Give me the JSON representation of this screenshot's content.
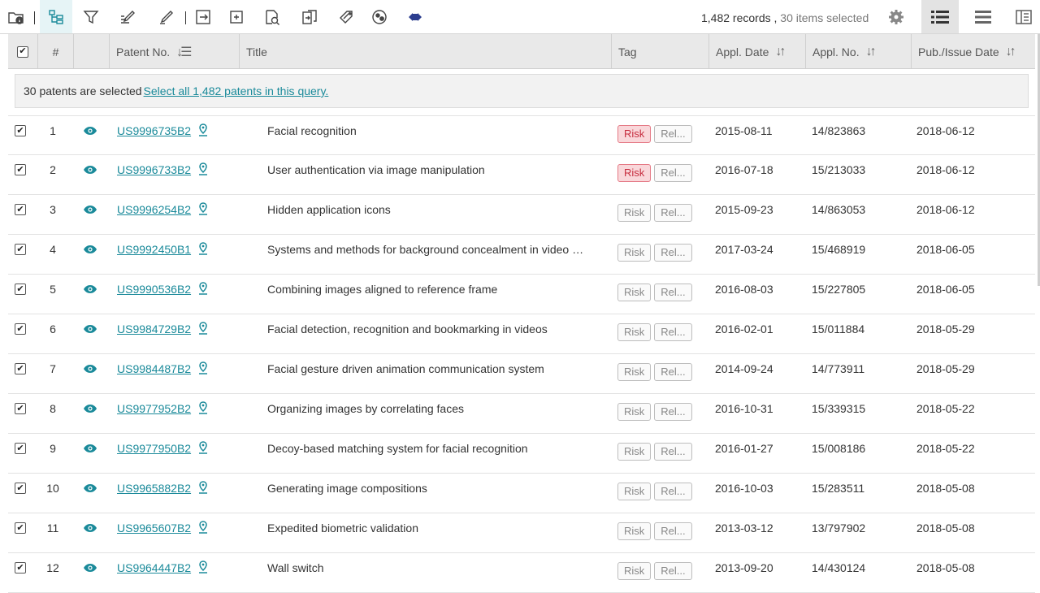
{
  "toolbar": {
    "records_text": "1,482 records ,",
    "selected_text": "30 items selected",
    "icons": [
      "folder-info-icon",
      "tree-view-icon",
      "filter-icon",
      "edit-list-icon",
      "highlight-pen-icon",
      "export-icon",
      "add-icon",
      "search-doc-icon",
      "compare-icon",
      "tag-icon",
      "analytics-icon",
      "collapse-icon",
      "settings-icon",
      "list-view-icon",
      "compact-view-icon",
      "split-view-icon"
    ]
  },
  "table": {
    "headers": {
      "number": "#",
      "patent_no": "Patent No.",
      "title": "Title",
      "tag": "Tag",
      "appl_date": "Appl. Date",
      "appl_no": "Appl. No.",
      "pub_date": "Pub./Issue Date"
    }
  },
  "banner": {
    "text": "30 patents are selected",
    "link": "Select all 1,482 patents in this query."
  },
  "tags": {
    "risk": "Risk",
    "rel": "Rel..."
  },
  "rows": [
    {
      "num": "1",
      "patent": "US9996735B2",
      "title": "Facial recognition",
      "risk": true,
      "appl_date": "2015-08-11",
      "appl_no": "14/823863",
      "pub_date": "2018-06-12"
    },
    {
      "num": "2",
      "patent": "US9996733B2",
      "title": "User authentication via image manipulation",
      "risk": true,
      "appl_date": "2016-07-18",
      "appl_no": "15/213033",
      "pub_date": "2018-06-12"
    },
    {
      "num": "3",
      "patent": "US9996254B2",
      "title": "Hidden application icons",
      "risk": false,
      "appl_date": "2015-09-23",
      "appl_no": "14/863053",
      "pub_date": "2018-06-12"
    },
    {
      "num": "4",
      "patent": "US9992450B1",
      "title": "Systems and methods for background concealment in video …",
      "risk": false,
      "appl_date": "2017-03-24",
      "appl_no": "15/468919",
      "pub_date": "2018-06-05"
    },
    {
      "num": "5",
      "patent": "US9990536B2",
      "title": "Combining images aligned to reference frame",
      "risk": false,
      "appl_date": "2016-08-03",
      "appl_no": "15/227805",
      "pub_date": "2018-06-05"
    },
    {
      "num": "6",
      "patent": "US9984729B2",
      "title": "Facial detection, recognition and bookmarking in videos",
      "risk": false,
      "appl_date": "2016-02-01",
      "appl_no": "15/011884",
      "pub_date": "2018-05-29"
    },
    {
      "num": "7",
      "patent": "US9984487B2",
      "title": "Facial gesture driven animation communication system",
      "risk": false,
      "appl_date": "2014-09-24",
      "appl_no": "14/773911",
      "pub_date": "2018-05-29"
    },
    {
      "num": "8",
      "patent": "US9977952B2",
      "title": "Organizing images by correlating faces",
      "risk": false,
      "appl_date": "2016-10-31",
      "appl_no": "15/339315",
      "pub_date": "2018-05-22"
    },
    {
      "num": "9",
      "patent": "US9977950B2",
      "title": "Decoy-based matching system for facial recognition",
      "risk": false,
      "appl_date": "2016-01-27",
      "appl_no": "15/008186",
      "pub_date": "2018-05-22"
    },
    {
      "num": "10",
      "patent": "US9965882B2",
      "title": "Generating image compositions",
      "risk": false,
      "appl_date": "2016-10-03",
      "appl_no": "15/283511",
      "pub_date": "2018-05-08"
    },
    {
      "num": "11",
      "patent": "US9965607B2",
      "title": "Expedited biometric validation",
      "risk": false,
      "appl_date": "2013-03-12",
      "appl_no": "13/797902",
      "pub_date": "2018-05-08"
    },
    {
      "num": "12",
      "patent": "US9964447B2",
      "title": "Wall switch",
      "risk": false,
      "appl_date": "2013-09-20",
      "appl_no": "14/430124",
      "pub_date": "2018-05-08"
    }
  ],
  "colors": {
    "accent": "#1a8a9a",
    "risk_bg": "#f9d7da",
    "risk_text": "#c62c3e"
  }
}
